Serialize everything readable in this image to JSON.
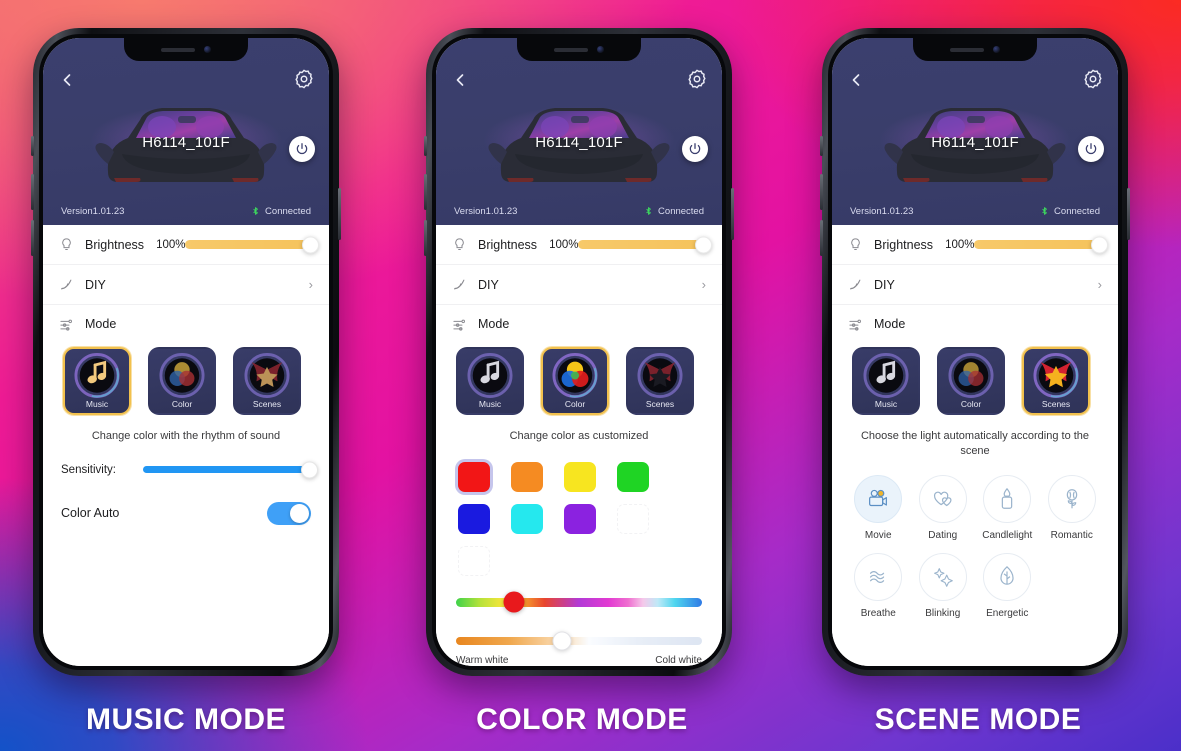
{
  "background": {
    "colors": [
      "#f77a6e",
      "#fb2b22",
      "#ef1b95",
      "#a62bc8",
      "#1352c8"
    ]
  },
  "device": {
    "name": "H6114_101F",
    "version": "Version1.01.23",
    "connection_status": "Connected",
    "back_icon": "chevron-left-icon",
    "settings_icon": "gear-icon",
    "power_icon": "power-icon",
    "bluetooth_icon": "bluetooth-icon"
  },
  "controls": {
    "brightness_label": "Brightness",
    "brightness_value": "100%",
    "brightness_percent": 100,
    "brightness_icon": "bulb-icon",
    "diy_label": "DIY",
    "diy_icon": "pen-icon",
    "diy_chevron": "chevron-right-icon",
    "mode_label": "Mode",
    "mode_icon": "sliders-icon"
  },
  "modes": [
    {
      "id": "music",
      "label": "Music",
      "icon": "music-note-icon"
    },
    {
      "id": "color",
      "label": "Color",
      "icon": "color-circles-icon"
    },
    {
      "id": "scenes",
      "label": "Scenes",
      "icon": "star-curtain-icon"
    }
  ],
  "phones": [
    {
      "caption": "MUSIC MODE",
      "selected_mode": "music",
      "description": "Change color with the rhythm of sound",
      "sensitivity_label": "Sensitivity:",
      "sensitivity_percent": 100,
      "color_auto_label": "Color Auto",
      "color_auto_on": true
    },
    {
      "caption": "COLOR MODE",
      "selected_mode": "color",
      "description": "Change color as customized",
      "swatches": [
        {
          "name": "red",
          "hex": "#f21616",
          "selected": true
        },
        {
          "name": "orange",
          "hex": "#f58b22",
          "selected": false
        },
        {
          "name": "yellow",
          "hex": "#f7e520",
          "selected": false
        },
        {
          "name": "green",
          "hex": "#1fd424",
          "selected": false
        },
        {
          "name": "blue",
          "hex": "#1a1ae0",
          "selected": false
        },
        {
          "name": "cyan",
          "hex": "#25e8ee",
          "selected": false
        },
        {
          "name": "purple",
          "hex": "#8b22e0",
          "selected": false
        }
      ],
      "hue_slider_percent": 22,
      "white_slider_percent": 41,
      "warm_white_label": "Warm white",
      "cold_white_label": "Cold white"
    },
    {
      "caption": "SCENE MODE",
      "selected_mode": "scenes",
      "description": "Choose the light automatically according to the scene",
      "scenes": [
        {
          "label": "Movie",
          "icon": "movie-camera-icon",
          "selected": true
        },
        {
          "label": "Dating",
          "icon": "hearts-icon",
          "selected": false
        },
        {
          "label": "Candlelight",
          "icon": "candle-icon",
          "selected": false
        },
        {
          "label": "Romantic",
          "icon": "rose-icon",
          "selected": false
        },
        {
          "label": "Breathe",
          "icon": "wave-icon",
          "selected": false
        },
        {
          "label": "Blinking",
          "icon": "sparkle-icon",
          "selected": false
        },
        {
          "label": "Energetic",
          "icon": "leaf-icon",
          "selected": false
        }
      ]
    }
  ]
}
